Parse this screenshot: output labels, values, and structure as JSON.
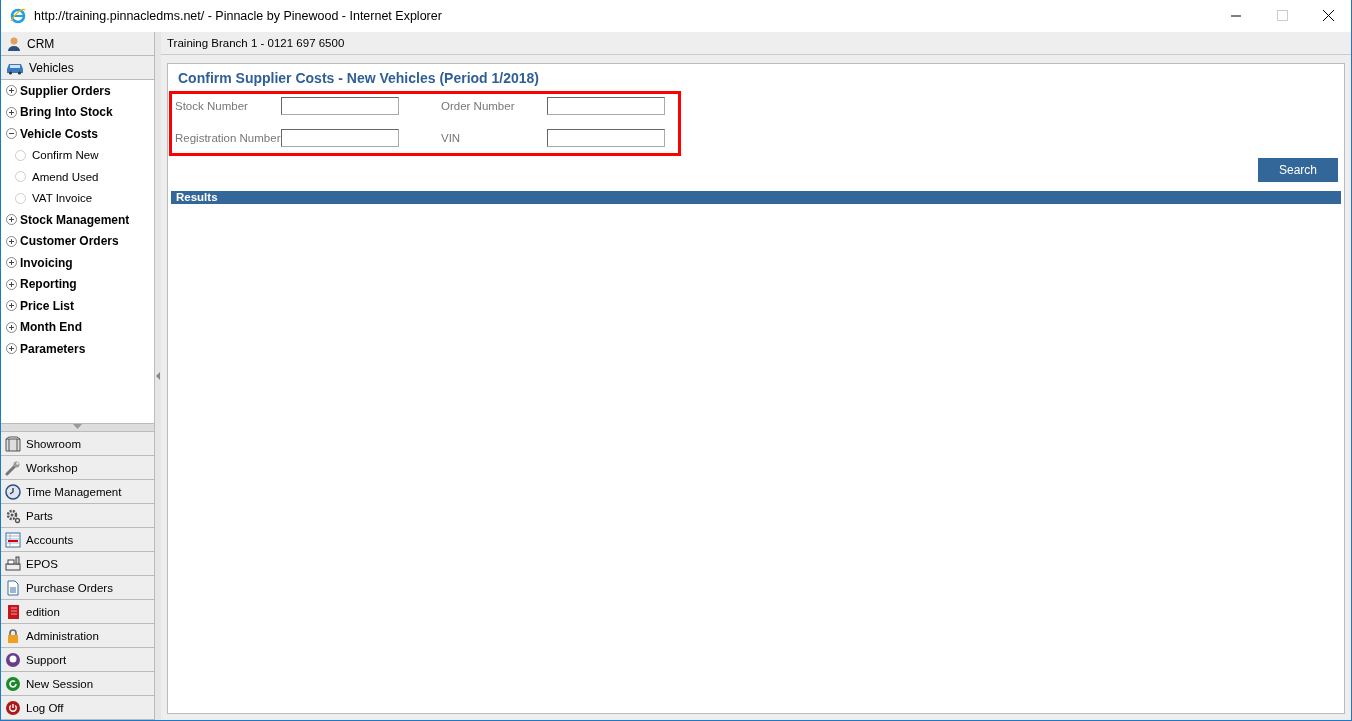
{
  "window": {
    "title": "http://training.pinnacledms.net/ - Pinnacle by Pinewood - Internet Explorer"
  },
  "sidebar": {
    "top_items": [
      "CRM",
      "Vehicles"
    ],
    "tree": [
      {
        "label": "Supplier Orders",
        "expanded": false
      },
      {
        "label": "Bring Into Stock",
        "expanded": false
      },
      {
        "label": "Vehicle Costs",
        "expanded": true,
        "children": [
          {
            "label": "Confirm New"
          },
          {
            "label": "Amend Used"
          },
          {
            "label": "VAT Invoice"
          }
        ]
      },
      {
        "label": "Stock Management",
        "expanded": false
      },
      {
        "label": "Customer Orders",
        "expanded": false
      },
      {
        "label": "Invoicing",
        "expanded": false
      },
      {
        "label": "Reporting",
        "expanded": false
      },
      {
        "label": "Price List",
        "expanded": false
      },
      {
        "label": "Month End",
        "expanded": false
      },
      {
        "label": "Parameters",
        "expanded": false
      }
    ],
    "modules": [
      "Showroom",
      "Workshop",
      "Time Management",
      "Parts",
      "Accounts",
      "EPOS",
      "Purchase Orders",
      "edition",
      "Administration",
      "Support",
      "New Session",
      "Log Off"
    ]
  },
  "header": {
    "branch": "Training Branch 1 - 0121 697 6500"
  },
  "page": {
    "title": "Confirm Supplier Costs - New Vehicles (Period 1/2018)",
    "fields": [
      {
        "label": "Stock Number"
      },
      {
        "label": "Order Number"
      },
      {
        "label": "Registration Number"
      },
      {
        "label": "VIN"
      }
    ],
    "search_button": "Search",
    "results_title": "Results"
  }
}
